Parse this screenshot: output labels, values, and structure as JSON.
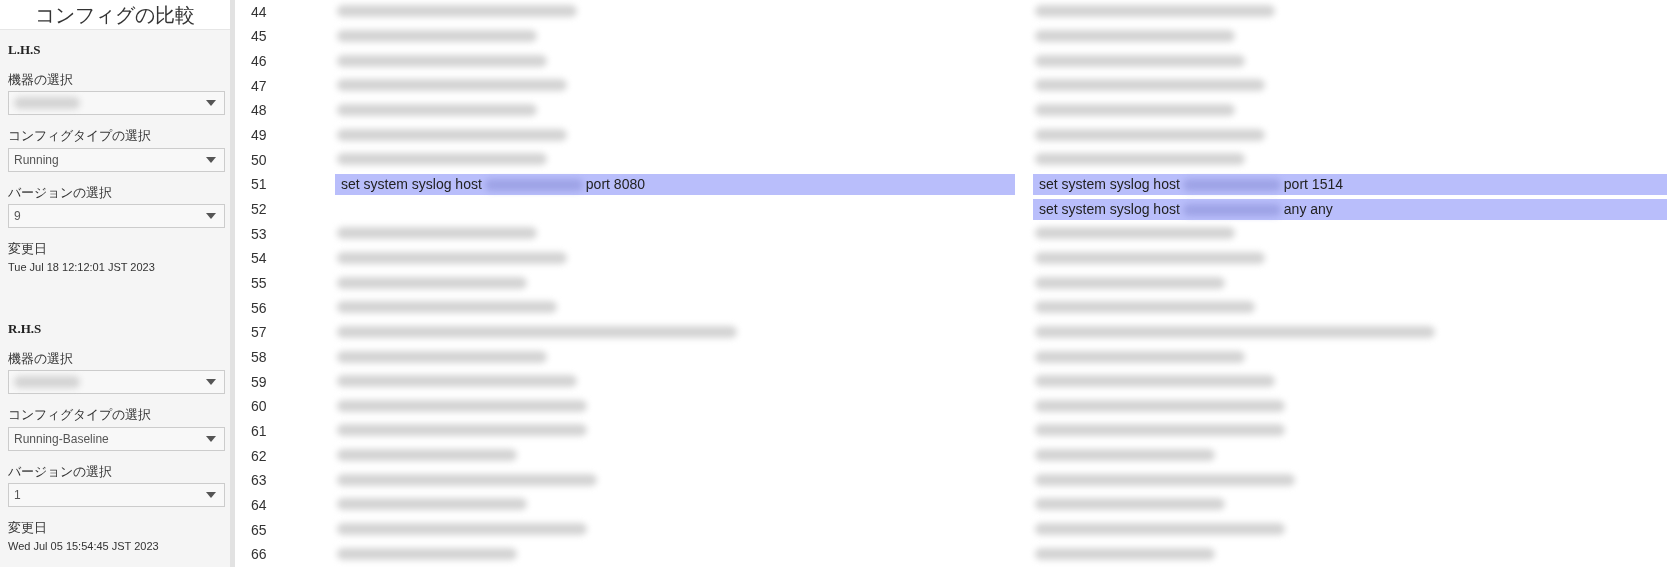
{
  "title": "コンフィグの比較",
  "sides": [
    {
      "heading": "L.H.S",
      "fields": [
        {
          "label": "機器の選択",
          "kind": "redacted"
        },
        {
          "label": "コンフィグタイプの選択",
          "kind": "text",
          "value": "Running"
        },
        {
          "label": "バージョンの選択",
          "kind": "text",
          "value": "9"
        }
      ],
      "date_label": "変更日",
      "date": "Tue Jul 18 12:12:01 JST 2023"
    },
    {
      "heading": "R.H.S",
      "fields": [
        {
          "label": "機器の選択",
          "kind": "redacted"
        },
        {
          "label": "コンフィグタイプの選択",
          "kind": "text",
          "value": "Running-Baseline"
        },
        {
          "label": "バージョンの選択",
          "kind": "text",
          "value": "1"
        }
      ],
      "date_label": "変更日",
      "date": "Wed Jul 05 15:54:45 JST 2023"
    }
  ],
  "rows": [
    {
      "number": "44",
      "kind": "blurred"
    },
    {
      "number": "45",
      "kind": "blurred"
    },
    {
      "number": "46",
      "kind": "blurred"
    },
    {
      "number": "47",
      "kind": "blurred"
    },
    {
      "number": "48",
      "kind": "blurred"
    },
    {
      "number": "49",
      "kind": "blurred"
    },
    {
      "number": "50",
      "kind": "blurred"
    },
    {
      "number": "51",
      "kind": "changed",
      "left": [
        {
          "kind": "text",
          "text": "set system syslog host"
        },
        {
          "kind": "redacted"
        },
        {
          "kind": "text",
          "text": "port 8080"
        }
      ],
      "right": [
        {
          "kind": "text",
          "text": "set system syslog host"
        },
        {
          "kind": "redacted"
        },
        {
          "kind": "text",
          "text": "port 1514"
        }
      ]
    },
    {
      "number": "52",
      "kind": "changed",
      "right": [
        {
          "kind": "text",
          "text": "set system syslog host"
        },
        {
          "kind": "redacted"
        },
        {
          "kind": "text",
          "text": "any any"
        }
      ]
    },
    {
      "number": "53",
      "kind": "blurred"
    },
    {
      "number": "54",
      "kind": "blurred"
    },
    {
      "number": "55",
      "kind": "blurred"
    },
    {
      "number": "56",
      "kind": "blurred"
    },
    {
      "number": "57",
      "kind": "blurred"
    },
    {
      "number": "58",
      "kind": "blurred"
    },
    {
      "number": "59",
      "kind": "blurred"
    },
    {
      "number": "60",
      "kind": "blurred"
    },
    {
      "number": "61",
      "kind": "blurred"
    },
    {
      "number": "62",
      "kind": "blurred"
    },
    {
      "number": "63",
      "kind": "blurred"
    },
    {
      "number": "64",
      "kind": "blurred"
    },
    {
      "number": "65",
      "kind": "blurred"
    },
    {
      "number": "66",
      "kind": "blurred"
    }
  ]
}
